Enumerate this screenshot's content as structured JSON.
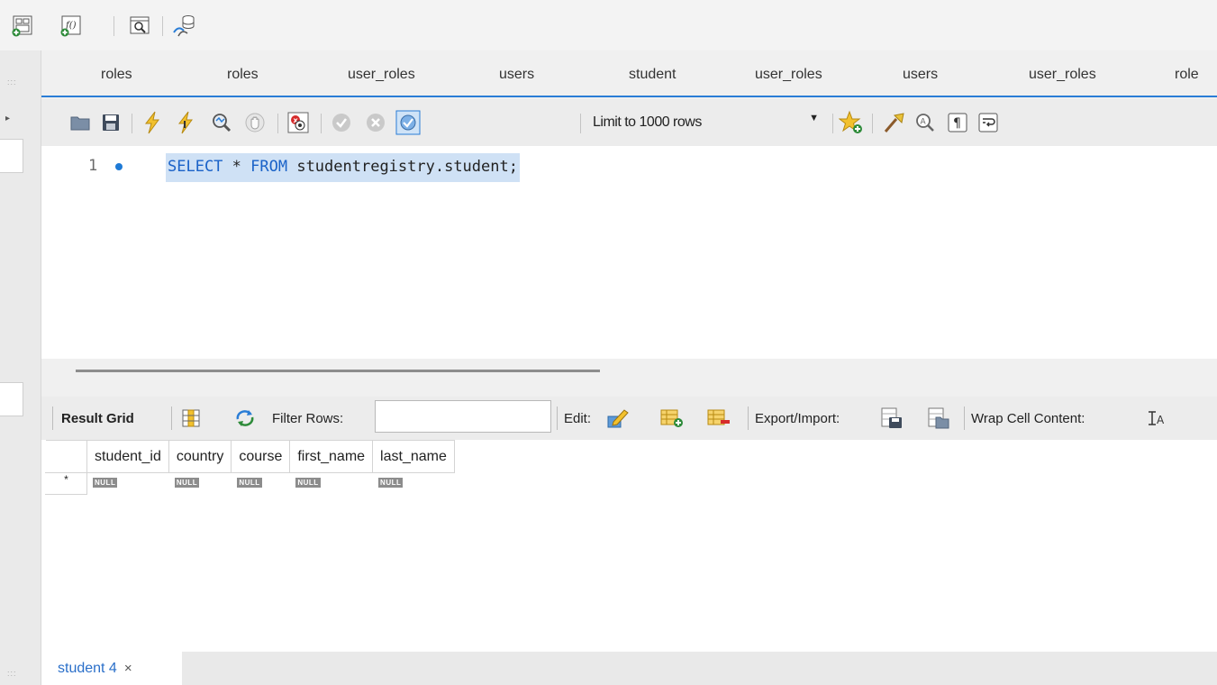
{
  "query_tabs": [
    "roles",
    "roles",
    "user_roles",
    "users",
    "student",
    "user_roles",
    "users",
    "user_roles",
    "role"
  ],
  "editor_toolbar": {
    "limit_label": "Limit to 1000 rows"
  },
  "editor": {
    "line_number": "1",
    "sql_keywords": [
      "SELECT",
      "FROM"
    ],
    "sql_keyword_1": "SELECT",
    "sql_star": " * ",
    "sql_keyword_2": "FROM",
    "sql_rest": " studentregistry.student;"
  },
  "result_toolbar": {
    "result_grid_label": "Result Grid",
    "filter_rows_label": "Filter Rows:",
    "filter_value": "",
    "edit_label": "Edit:",
    "export_import_label": "Export/Import:",
    "wrap_cell_label": "Wrap Cell Content:"
  },
  "grid": {
    "columns": [
      "student_id",
      "country",
      "course",
      "first_name",
      "last_name"
    ],
    "new_row_marker": "*",
    "null_text": "NULL"
  },
  "bottom_tabs": [
    {
      "label": "student 4",
      "close": "×"
    }
  ],
  "colors": {
    "accent": "#2a7dd6",
    "selection": "#cfe1f5",
    "keyword": "#1a62c8"
  }
}
